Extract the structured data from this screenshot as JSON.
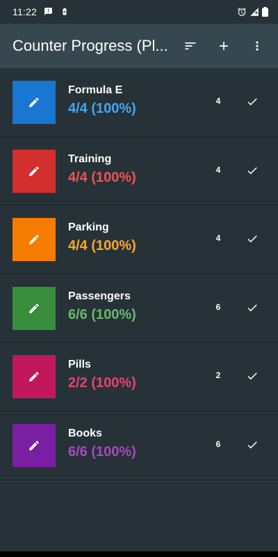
{
  "status_bar": {
    "time": "11:22",
    "icons": [
      "message-icon",
      "battery-saver-icon",
      "alarm-icon",
      "signal-icon",
      "battery-icon"
    ]
  },
  "app_bar": {
    "title": "Counter Progress (Pl...",
    "actions": [
      "sort-icon",
      "add-icon",
      "more-vert-icon"
    ]
  },
  "counters": [
    {
      "name": "Formula E",
      "progress": "4/4 (100%)",
      "count": "4",
      "color": "#1976d2",
      "text_color": "#42a5f5"
    },
    {
      "name": "Training",
      "progress": "4/4 (100%)",
      "count": "4",
      "color": "#d32f2f",
      "text_color": "#ef5350"
    },
    {
      "name": "Parking",
      "progress": "4/4 (100%)",
      "count": "4",
      "color": "#f57c00",
      "text_color": "#ffa726"
    },
    {
      "name": "Passengers",
      "progress": "6/6 (100%)",
      "count": "6",
      "color": "#388e3c",
      "text_color": "#66bb6a"
    },
    {
      "name": "Pills",
      "progress": "2/2 (100%)",
      "count": "2",
      "color": "#c2185b",
      "text_color": "#ec407a"
    },
    {
      "name": "Books",
      "progress": "6/6 (100%)",
      "count": "6",
      "color": "#7b1fa2",
      "text_color": "#ab47bc"
    }
  ]
}
